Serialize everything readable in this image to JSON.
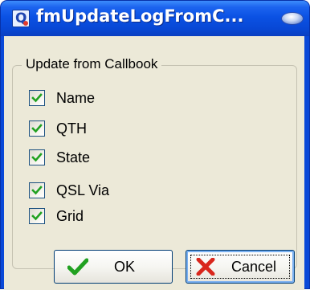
{
  "window": {
    "title": "fmUpdateLogFromC..."
  },
  "group": {
    "legend": "Update from Callbook"
  },
  "fields": [
    {
      "label": "Name",
      "checked": true
    },
    {
      "label": "QTH",
      "checked": true
    },
    {
      "label": "State",
      "checked": true
    },
    {
      "label": "QSL Via",
      "checked": true
    },
    {
      "label": "Grid",
      "checked": true
    }
  ],
  "buttons": {
    "ok_label": "OK",
    "cancel_label": "Cancel"
  },
  "icons": {
    "app": "app-q-icon",
    "ok": "green-checkmark-icon",
    "cancel": "red-x-icon"
  },
  "colors": {
    "titlebar": "#0b52e4",
    "client_bg": "#ece9d8",
    "checkmark": "#21a121",
    "cancel_x": "#d9261c"
  }
}
